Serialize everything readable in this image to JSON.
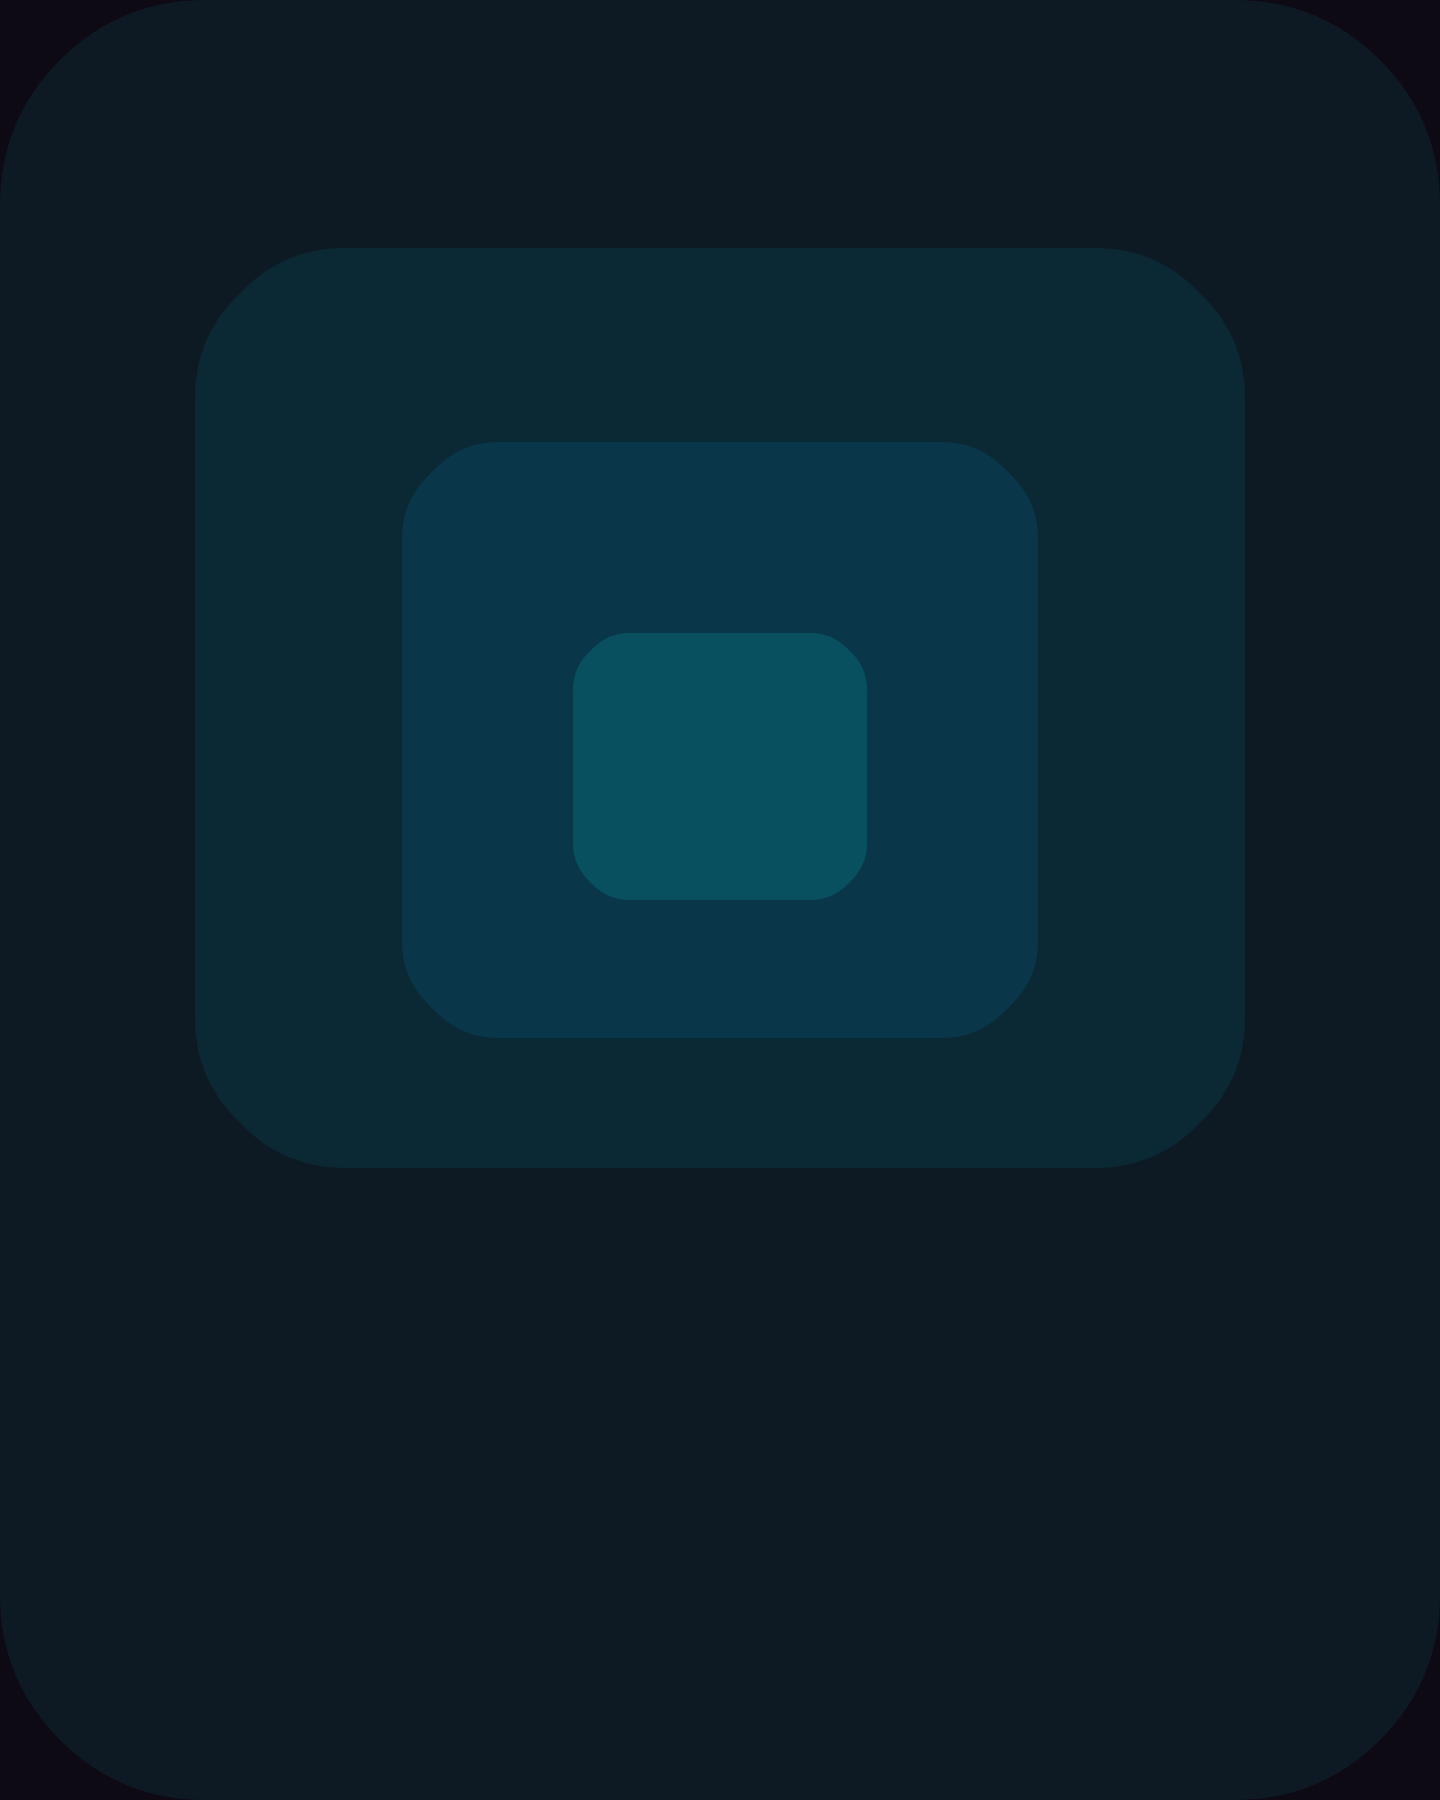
{
  "colors": {
    "page_background": "#0d0a14",
    "outer_panel": "#0d1a23",
    "layer_2": "#0b2835",
    "layer_3": "#093749",
    "core": "#08505f"
  },
  "shapes": [
    {
      "name": "outer-panel",
      "shape": "rounded-chamfered-rectangle",
      "color_key": "outer_panel"
    },
    {
      "name": "layer-2-panel",
      "shape": "rounded-chamfered-rectangle",
      "color_key": "layer_2"
    },
    {
      "name": "layer-3-panel",
      "shape": "rounded-chamfered-rectangle",
      "color_key": "layer_3"
    },
    {
      "name": "core-panel",
      "shape": "rounded-chamfered-rectangle",
      "color_key": "core"
    }
  ]
}
